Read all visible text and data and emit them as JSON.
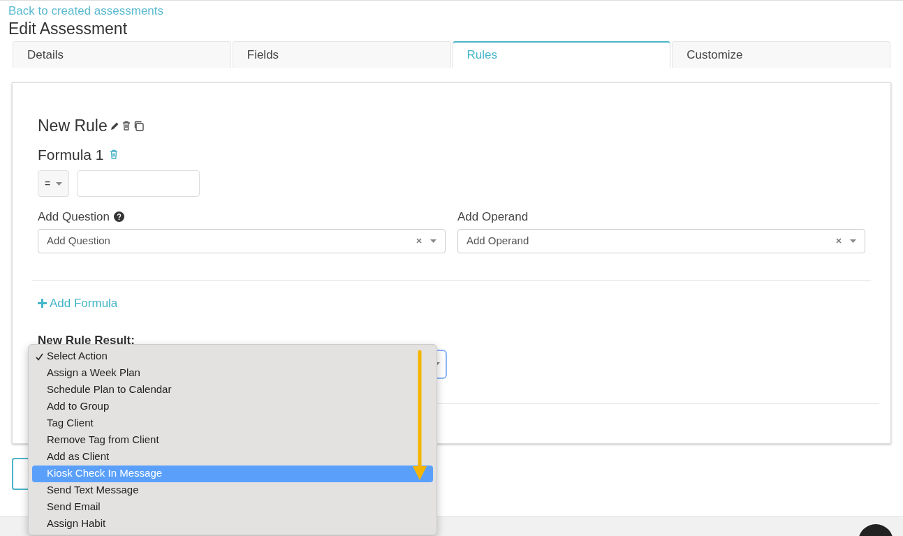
{
  "back_link": "Back to created assessments",
  "title": "Edit Assessment",
  "tabs": [
    {
      "label": "Details",
      "selected": false
    },
    {
      "label": "Fields",
      "selected": false
    },
    {
      "label": "Rules",
      "selected": true
    },
    {
      "label": "Customize",
      "selected": false
    }
  ],
  "rule": {
    "name": "New Rule",
    "formula_title": "Formula 1",
    "operator": "=",
    "question": {
      "label": "Add Question",
      "placeholder": "Add Question"
    },
    "operand": {
      "label": "Add Operand",
      "placeholder": "Add Operand"
    },
    "add_formula": "Add Formula",
    "result_label": "New Rule Result:"
  },
  "action_menu": {
    "items": [
      {
        "label": "Select Action",
        "checked": true,
        "selected": false
      },
      {
        "label": "Assign a Week Plan",
        "checked": false,
        "selected": false
      },
      {
        "label": "Schedule Plan to Calendar",
        "checked": false,
        "selected": false
      },
      {
        "label": "Add to Group",
        "checked": false,
        "selected": false
      },
      {
        "label": "Tag Client",
        "checked": false,
        "selected": false
      },
      {
        "label": "Remove Tag from Client",
        "checked": false,
        "selected": false
      },
      {
        "label": "Add as Client",
        "checked": false,
        "selected": false
      },
      {
        "label": "Kiosk Check In Message",
        "checked": false,
        "selected": true
      },
      {
        "label": "Send Text Message",
        "checked": false,
        "selected": false
      },
      {
        "label": "Send Email",
        "checked": false,
        "selected": false
      },
      {
        "label": "Assign Habit",
        "checked": false,
        "selected": false
      }
    ]
  }
}
